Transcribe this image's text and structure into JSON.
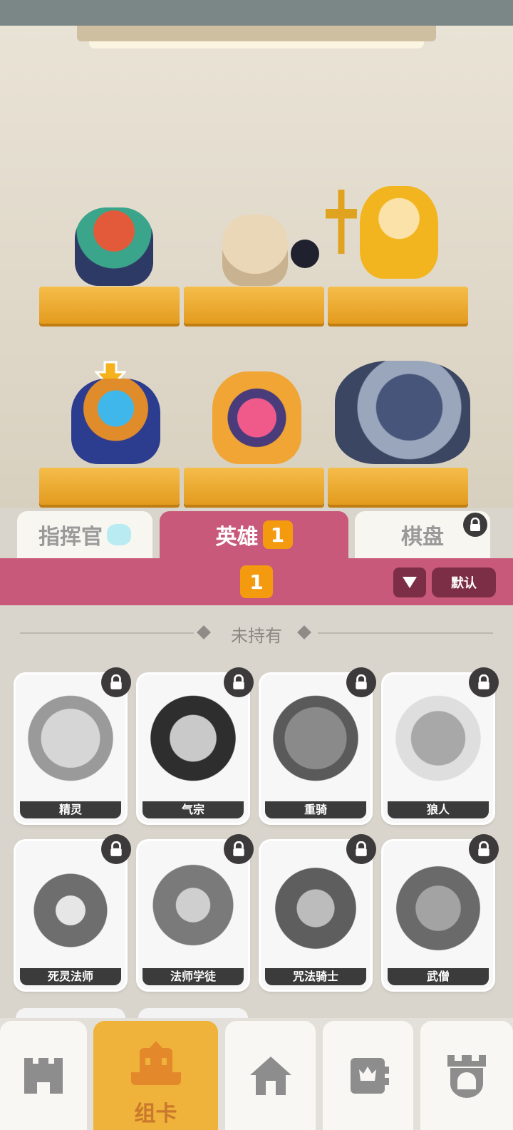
{
  "tabs": [
    {
      "label": "指挥官",
      "active": false
    },
    {
      "label": "英雄",
      "badge": "1",
      "active": true
    },
    {
      "label": "棋盘",
      "active": false,
      "locked": true
    }
  ],
  "filter_bar": {
    "count": "1",
    "sort_label": "默认"
  },
  "section": {
    "title": "未持有"
  },
  "heroes": [
    {
      "name": "精灵",
      "locked": true
    },
    {
      "name": "气宗",
      "locked": true
    },
    {
      "name": "重骑",
      "locked": true
    },
    {
      "name": "狼人",
      "locked": true
    },
    {
      "name": "死灵法师",
      "locked": true
    },
    {
      "name": "法师学徒",
      "locked": true
    },
    {
      "name": "咒法骑士",
      "locked": true
    },
    {
      "name": "武僧",
      "locked": true
    }
  ],
  "bottom_nav": [
    {
      "icon": "castle-icon",
      "label": ""
    },
    {
      "icon": "deck-icon",
      "label": "组卡",
      "active": true
    },
    {
      "icon": "home-icon",
      "label": ""
    },
    {
      "icon": "shop-icon",
      "label": ""
    },
    {
      "icon": "tower-icon",
      "label": ""
    }
  ],
  "colors": {
    "accent": "#c9597a",
    "badge": "#f39a0f",
    "shelf": "#f0ad35"
  }
}
